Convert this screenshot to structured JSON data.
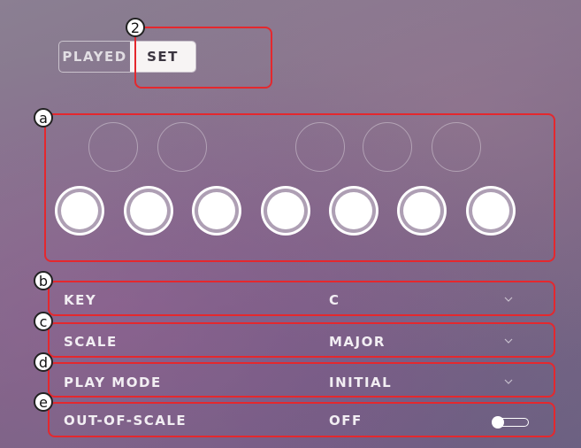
{
  "mode_toggle": {
    "played_label": "PLAYED",
    "set_label": "SET",
    "selected": "SET"
  },
  "callouts": {
    "toggle": "2",
    "notes": "a",
    "key": "b",
    "scale": "c",
    "play_mode": "d",
    "out_of_scale": "e"
  },
  "settings": {
    "key": {
      "label": "KEY",
      "value": "C"
    },
    "scale": {
      "label": "SCALE",
      "value": "MAJOR"
    },
    "play_mode": {
      "label": "PLAY MODE",
      "value": "INITIAL"
    },
    "out_of_scale": {
      "label": "OUT-OF-SCALE",
      "value": "OFF",
      "enabled": false
    }
  },
  "icons": {
    "dropdown": "chevron-down-icon",
    "switch": "toggle-switch-icon"
  },
  "colors": {
    "callout": "#e4282e",
    "selected_segment": "#f7f4f4",
    "text": "#f2eef3"
  }
}
